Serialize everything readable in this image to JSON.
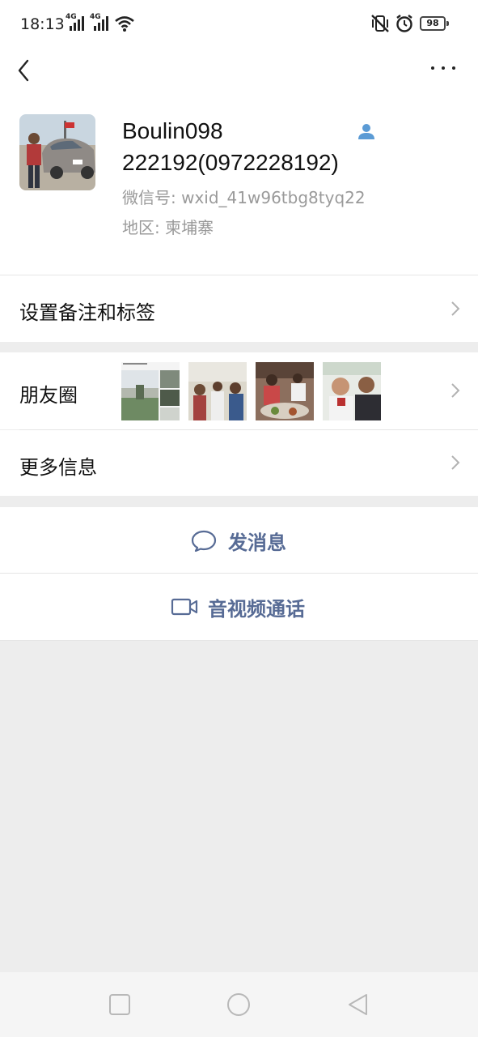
{
  "status_bar": {
    "time": "18:13",
    "network_1": "4G",
    "network_2": "4G",
    "battery": "98"
  },
  "nav": {
    "back_icon": "chevron-left-icon",
    "more_icon": "ellipsis-icon"
  },
  "profile": {
    "nickname": "Boulin098 222192(0972228192)",
    "wechat_id_label": "微信号:",
    "wechat_id": "wxid_41w96tbg8tyq22",
    "region_label": "地区:",
    "region": "柬埔寨",
    "contact_icon": "person-icon"
  },
  "cells": {
    "remark_tags": "设置备注和标签",
    "moments": "朋友圈",
    "more_info": "更多信息"
  },
  "actions": {
    "message": "发消息",
    "video_call": "音视频通话"
  },
  "colors": {
    "link_blue": "#576b95",
    "background_gray": "#ededed",
    "contact_icon_blue": "#5b9bd5"
  }
}
